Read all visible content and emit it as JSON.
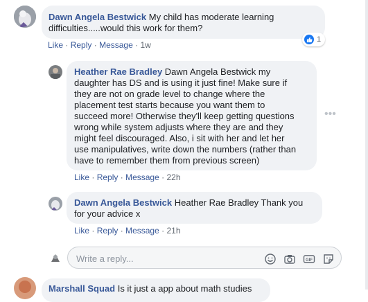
{
  "comments": [
    {
      "author": "Dawn Angela Bestwick",
      "text_line1": "My child has moderate learning",
      "text_line2": "difficulties.....would this work for them?",
      "reaction_count": "1",
      "like": "Like",
      "reply": "Reply",
      "message": "Message",
      "time": "1w"
    }
  ],
  "replies": [
    {
      "author": "Heather Rae Bradley",
      "lines": [
        "Dawn Angela Bestwick my",
        "daughter has DS and is using it just fine! Make sure if",
        "they are not on grade level to change where the",
        "placement test starts because you want them to",
        "succeed more! Otherwise they'll keep getting questions",
        "wrong while system adjusts where they are and they",
        "might feel discouraged. Also, i sit with her and let her",
        "use manipulatives, write down the numbers (rather than",
        "have to remember them from previous screen)"
      ],
      "like": "Like",
      "reply": "Reply",
      "message": "Message",
      "time": "22h"
    },
    {
      "author": "Dawn Angela Bestwick",
      "text_line1": "Heather Rae Bradley Thank you",
      "text_line2": "for your advice x",
      "like": "Like",
      "reply": "Reply",
      "message": "Message",
      "time": "21h"
    }
  ],
  "reply_box": {
    "placeholder": "Write a reply..."
  },
  "next_comment": {
    "author": "Marshall Squad",
    "text": "Is it just a app about math studies"
  },
  "icons": [
    "like-icon",
    "more-icon",
    "emoji-icon",
    "camera-icon",
    "gif-icon",
    "sticker-icon"
  ],
  "colors": {
    "link": "#385898",
    "bubble": "#f0f2f5",
    "meta": "#606770",
    "like_blue": "#1877f2"
  }
}
